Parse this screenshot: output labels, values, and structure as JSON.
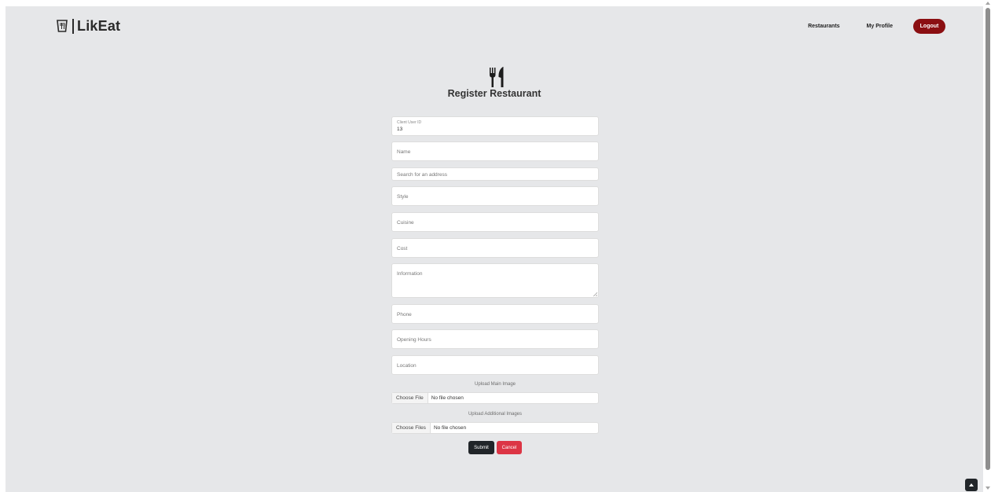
{
  "brand": {
    "name": "LikEat"
  },
  "nav": {
    "restaurants": "Restaurants",
    "my_profile": "My Profile",
    "logout": "Logout"
  },
  "page": {
    "title": "Register Restaurant"
  },
  "form": {
    "client_user_id": {
      "label": "Client User ID",
      "value": "13"
    },
    "name": {
      "placeholder": "Name"
    },
    "address": {
      "placeholder": "Search for an address"
    },
    "style": {
      "placeholder": "Style"
    },
    "cuisine": {
      "placeholder": "Cuisine"
    },
    "cost": {
      "placeholder": "Cost"
    },
    "information": {
      "placeholder": "Information"
    },
    "phone": {
      "placeholder": "Phone"
    },
    "opening_hours": {
      "placeholder": "Opening Hours"
    },
    "location": {
      "placeholder": "Location"
    },
    "main_image": {
      "label": "Upload Main Image",
      "button": "Choose File",
      "status": "No file chosen"
    },
    "additional_images": {
      "label": "Upload Additional Images",
      "button": "Choose Files",
      "status": "No file chosen"
    },
    "submit": "Submit",
    "cancel": "Cancel"
  },
  "colors": {
    "background": "#e6e7e9",
    "logout": "#8b0f12",
    "submit": "#212529",
    "cancel": "#dc3545"
  },
  "icons": {
    "brand": "cup-fork-knife-icon",
    "title": "utensils-icon",
    "back_to_top": "chevron-up-icon"
  }
}
